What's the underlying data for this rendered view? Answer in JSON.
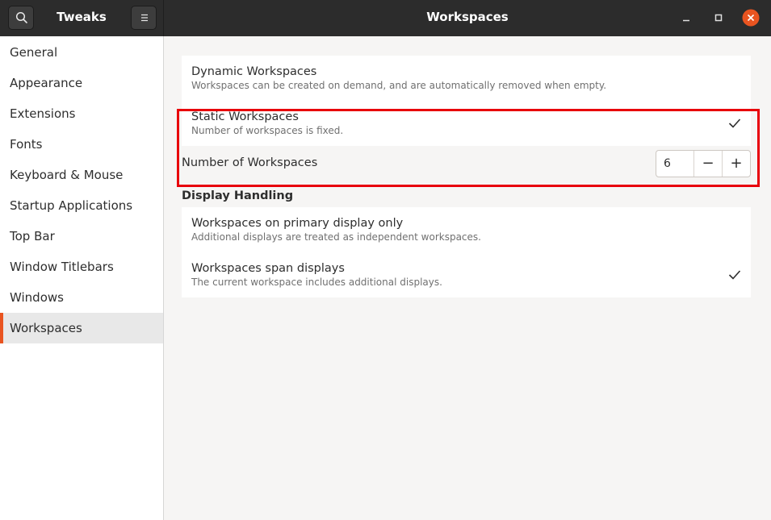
{
  "header": {
    "app_title": "Tweaks",
    "page_title": "Workspaces",
    "search_icon": "search-icon",
    "menu_icon": "hamburger-menu-icon",
    "close_color": "#e95420"
  },
  "sidebar": {
    "items": [
      {
        "label": "General"
      },
      {
        "label": "Appearance"
      },
      {
        "label": "Extensions"
      },
      {
        "label": "Fonts"
      },
      {
        "label": "Keyboard & Mouse"
      },
      {
        "label": "Startup Applications"
      },
      {
        "label": "Top Bar"
      },
      {
        "label": "Window Titlebars"
      },
      {
        "label": "Windows"
      },
      {
        "label": "Workspaces"
      }
    ],
    "selected": "Workspaces",
    "accent_color": "#e95420"
  },
  "main": {
    "dynamic": {
      "title": "Dynamic Workspaces",
      "subtitle": "Workspaces can be created on demand, and are automatically removed when empty.",
      "checked": false
    },
    "static": {
      "title": "Static Workspaces",
      "subtitle": "Number of workspaces is fixed.",
      "checked": true
    },
    "number": {
      "label": "Number of Workspaces",
      "value": "6",
      "minus": "−",
      "plus": "+"
    },
    "display_heading": "Display Handling",
    "primary_only": {
      "title": "Workspaces on primary display only",
      "subtitle": "Additional displays are treated as independent workspaces.",
      "checked": false
    },
    "span": {
      "title": "Workspaces span displays",
      "subtitle": "The current workspace includes additional displays.",
      "checked": true
    }
  },
  "annotation": {
    "highlight_color": "#e8000b"
  }
}
